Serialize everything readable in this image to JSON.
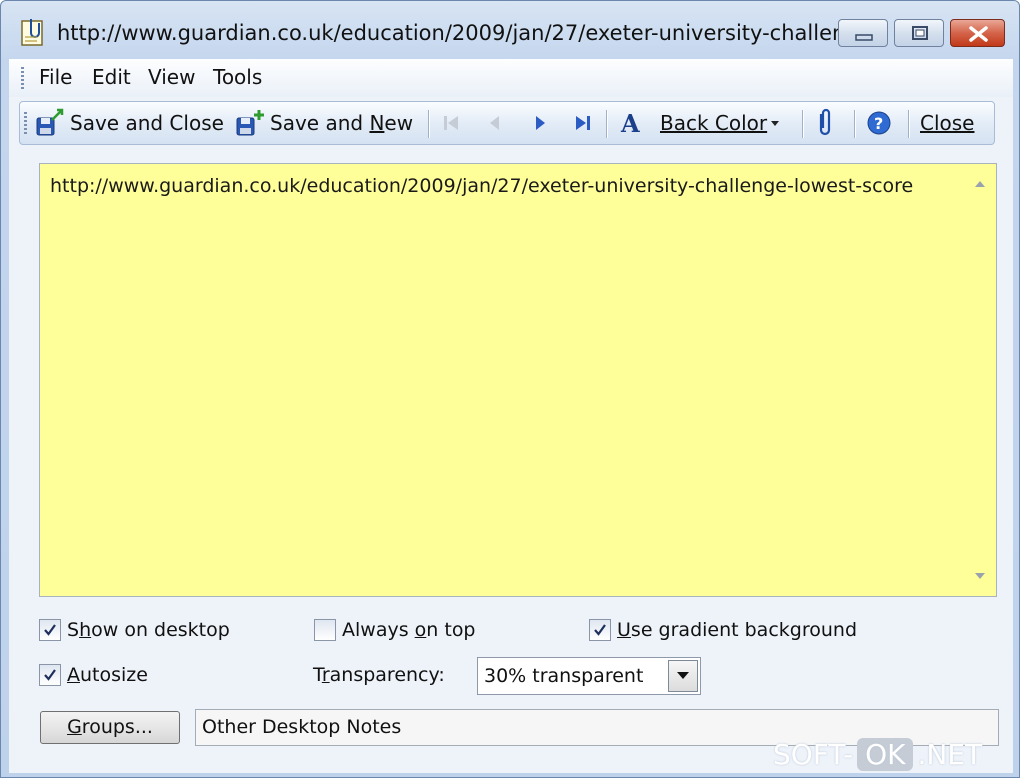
{
  "window": {
    "title": "http://www.guardian.co.uk/education/2009/jan/27/exeter-university-challen..."
  },
  "menu": {
    "items": [
      {
        "label": "File"
      },
      {
        "label": "Edit"
      },
      {
        "label": "View"
      },
      {
        "label": "Tools"
      }
    ]
  },
  "toolbar": {
    "save_close_label": "Save and Close",
    "save_new_label_pre": "Save and ",
    "save_new_label_ul": "N",
    "save_new_label_post": "ew",
    "back_color_label": "Back Color",
    "close_label": "Close"
  },
  "note": {
    "text": "http://www.guardian.co.uk/education/2009/jan/27/exeter-university-challenge-lowest-score"
  },
  "options": {
    "show_on_desktop": {
      "label_pre": "S",
      "label_ul": "h",
      "label_post": "ow on desktop",
      "checked": true
    },
    "always_on_top": {
      "label_pre": "Always ",
      "label_ul": "o",
      "label_post": "n top",
      "checked": false
    },
    "use_gradient": {
      "label_pre": "",
      "label_ul": "U",
      "label_post": "se gradient background",
      "checked": true
    },
    "autosize": {
      "label_pre": "",
      "label_ul": "A",
      "label_post": "utosize",
      "checked": true
    },
    "transparency_label_pre": "T",
    "transparency_label_ul": "r",
    "transparency_label_post": "ansparency:",
    "transparency_value": "30% transparent"
  },
  "groups": {
    "button_pre": "",
    "button_ul": "G",
    "button_post": "roups...",
    "value": "Other Desktop Notes"
  },
  "watermark": {
    "left": "SOFT-",
    "ok": "OK",
    "right": ".NET"
  },
  "colors": {
    "note_background": "#ffff99",
    "close_button": "#d4644a"
  }
}
